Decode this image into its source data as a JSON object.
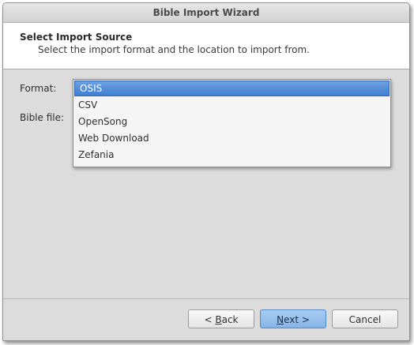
{
  "window": {
    "title": "Bible Import Wizard"
  },
  "header": {
    "title": "Select Import Source",
    "subtitle": "Select the import format and the location to import from."
  },
  "form": {
    "format_label": "Format:",
    "bible_file_label": "Bible file:",
    "format_options": [
      "OSIS",
      "CSV",
      "OpenSong",
      "Web Download",
      "Zefania"
    ],
    "format_selected": "OSIS"
  },
  "buttons": {
    "back_prefix": "< ",
    "back_mnemonic": "B",
    "back_rest": "ack",
    "next_mnemonic": "N",
    "next_rest": "ext >",
    "cancel_label": "Cancel"
  },
  "colors": {
    "selection_highlight": "#3f7ed2",
    "primary_button": "#85b4e8"
  }
}
